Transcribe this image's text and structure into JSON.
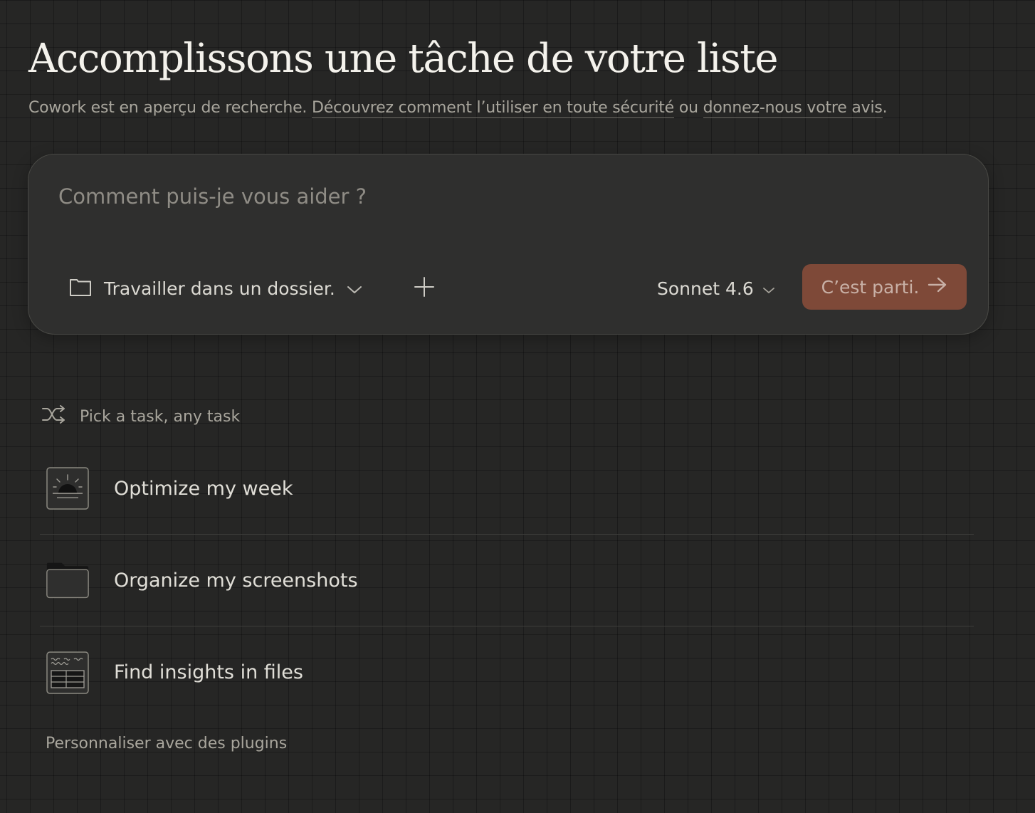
{
  "header": {
    "title": "Accomplissons une tâche de votre liste",
    "subtitle_prefix": "Cowork est en aperçu de recherche.",
    "link_safety": "Découvrez comment l’utiliser en toute sécurité",
    "subtitle_or": "ou",
    "link_feedback": "donnez-nous votre avis",
    "subtitle_suffix": "."
  },
  "composer": {
    "placeholder": "Comment puis-je vous aider ?",
    "folder_label": "Travailler dans un dossier.",
    "model_label": "Sonnet 4.6",
    "submit_label": "C’est parti.",
    "accent_color": "#7e4938"
  },
  "tasks": {
    "section_label": "Pick a task, any task",
    "items": [
      {
        "label": "Optimize my week",
        "icon": "sunrise-calendar-icon"
      },
      {
        "label": "Organize my screenshots",
        "icon": "folder-icon"
      },
      {
        "label": "Find insights in files",
        "icon": "spreadsheet-icon"
      }
    ]
  },
  "footer": {
    "plugins_label": "Personnaliser avec des plugins"
  }
}
